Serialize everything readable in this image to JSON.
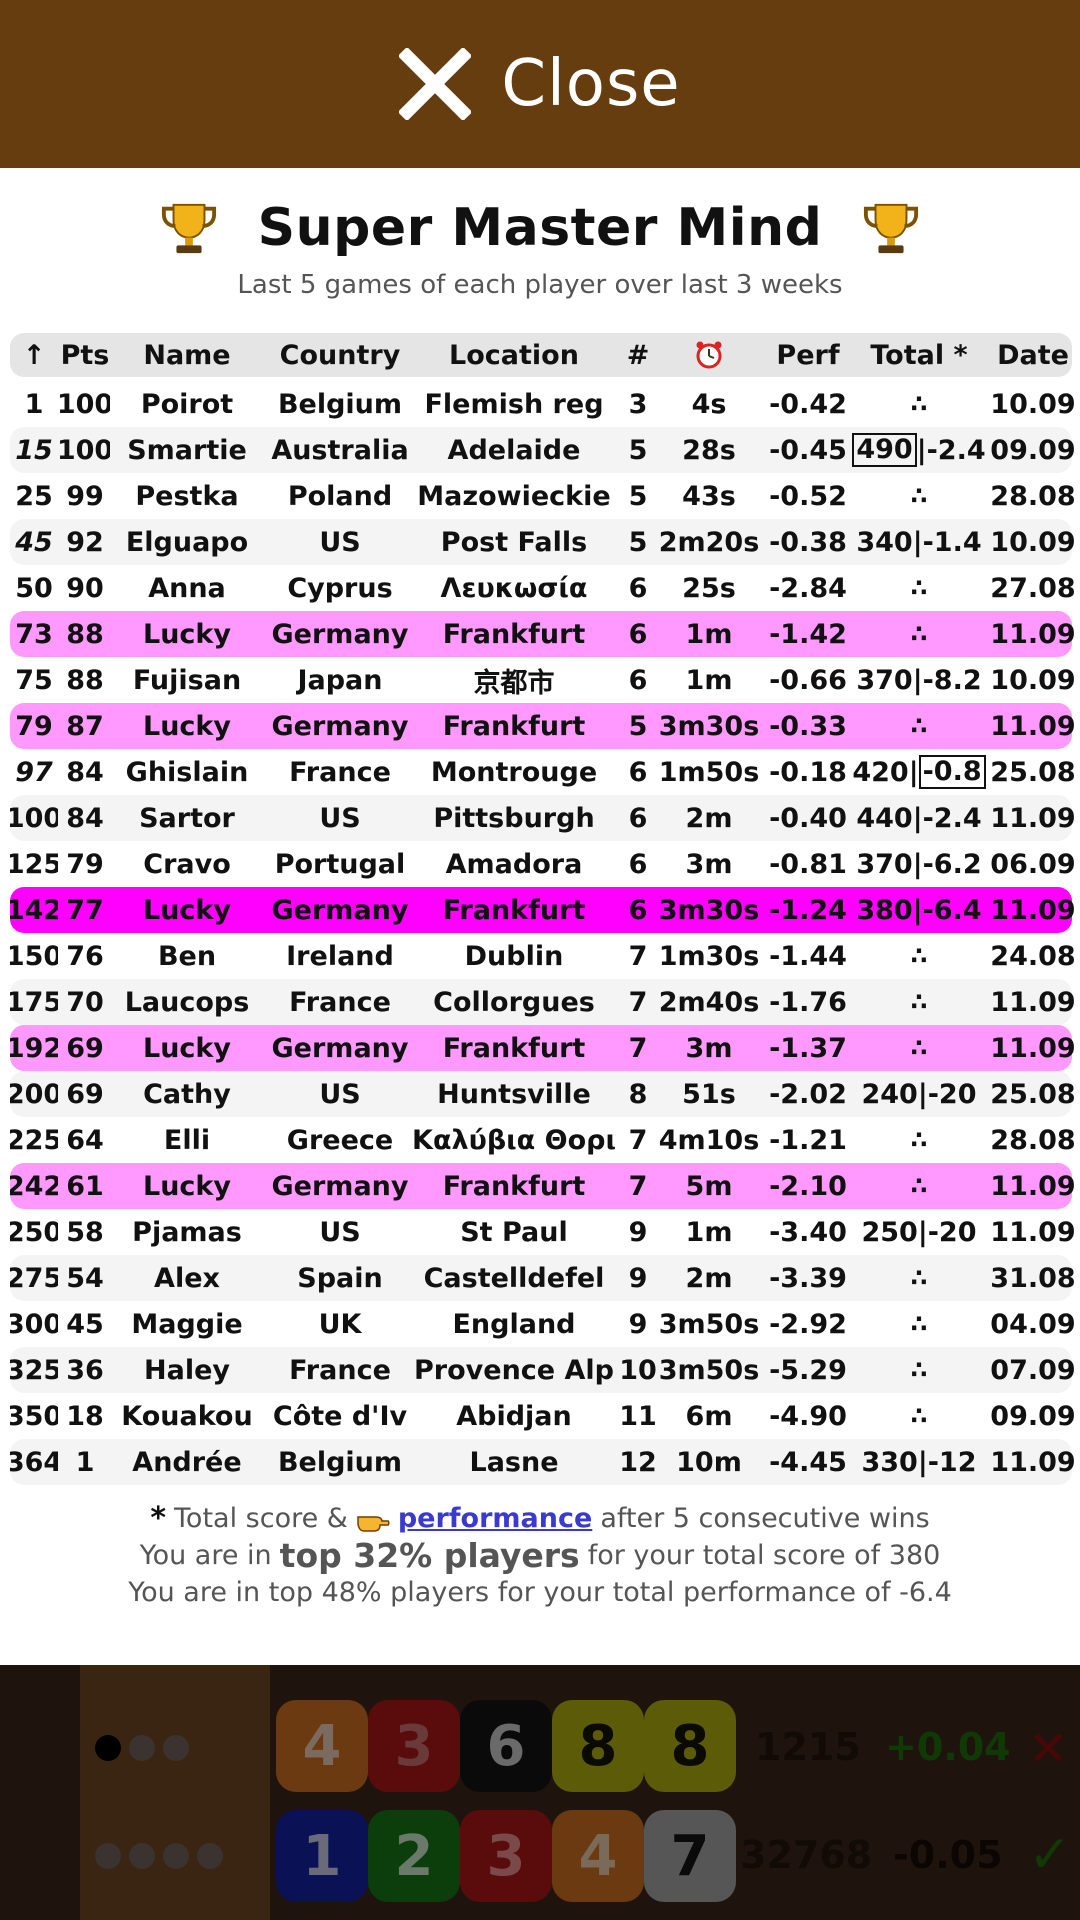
{
  "close": {
    "label": "Close"
  },
  "title": "Super Master Mind",
  "subtitle": "Last 5 games of each player over last 3 weeks",
  "columns": [
    "↑",
    "Pts",
    "Name",
    "Country",
    "Location",
    "#",
    "⏰",
    "Perf",
    "Total *",
    "Date"
  ],
  "rows": [
    {
      "rank": "1",
      "pts": "100",
      "name": "Poirot",
      "country": "Belgium",
      "location": "Flemish reg",
      "n": "3",
      "time": "4s",
      "perf": "-0.42",
      "total": "∴",
      "date": "10.09"
    },
    {
      "rank": "15",
      "pts": "100",
      "name": "Smartie",
      "country": "Australia",
      "location": "Adelaide",
      "n": "5",
      "time": "28s",
      "perf": "-0.45",
      "total_score": "490",
      "total_perf": "-2.4",
      "date": "09.09"
    },
    {
      "rank": "25",
      "pts": "99",
      "name": "Pestka",
      "country": "Poland",
      "location": "Mazowieckie",
      "n": "5",
      "time": "43s",
      "perf": "-0.52",
      "total": "∴",
      "date": "28.08"
    },
    {
      "rank": "45",
      "pts": "92",
      "name": "Elguapo",
      "country": "US",
      "location": "Post Falls",
      "n": "5",
      "time": "2m20s",
      "perf": "-0.38",
      "total": "340|-1.4",
      "date": "10.09"
    },
    {
      "rank": "50",
      "pts": "90",
      "name": "Anna",
      "country": "Cyprus",
      "location": "Λευκωσία",
      "n": "6",
      "time": "25s",
      "perf": "-2.84",
      "total": "∴",
      "date": "27.08"
    },
    {
      "rank": "73",
      "pts": "88",
      "name": "Lucky",
      "country": "Germany",
      "location": "Frankfurt",
      "n": "6",
      "time": "1m",
      "perf": "-1.42",
      "total": "∴",
      "date": "11.09"
    },
    {
      "rank": "75",
      "pts": "88",
      "name": "Fujisan",
      "country": "Japan",
      "location": "京都市",
      "n": "6",
      "time": "1m",
      "perf": "-0.66",
      "total": "370|-8.2",
      "date": "10.09"
    },
    {
      "rank": "79",
      "pts": "87",
      "name": "Lucky",
      "country": "Germany",
      "location": "Frankfurt",
      "n": "5",
      "time": "3m30s",
      "perf": "-0.33",
      "total": "∴",
      "date": "11.09"
    },
    {
      "rank": "97",
      "pts": "84",
      "name": "Ghislain",
      "country": "France",
      "location": "Montrouge",
      "n": "6",
      "time": "1m50s",
      "perf": "-0.18",
      "total_score": "420",
      "total_perf": "-0.8",
      "date": "25.08"
    },
    {
      "rank": "100",
      "pts": "84",
      "name": "Sartor",
      "country": "US",
      "location": "Pittsburgh",
      "n": "6",
      "time": "2m",
      "perf": "-0.40",
      "total": "440|-2.4",
      "date": "11.09"
    },
    {
      "rank": "125",
      "pts": "79",
      "name": "Cravo",
      "country": "Portugal",
      "location": "Amadora",
      "n": "6",
      "time": "3m",
      "perf": "-0.81",
      "total": "370|-6.2",
      "date": "06.09"
    },
    {
      "rank": "142",
      "pts": "77",
      "name": "Lucky",
      "country": "Germany",
      "location": "Frankfurt",
      "n": "6",
      "time": "3m30s",
      "perf": "-1.24",
      "total": "380|-6.4",
      "date": "11.09"
    },
    {
      "rank": "150",
      "pts": "76",
      "name": "Ben",
      "country": "Ireland",
      "location": "Dublin",
      "n": "7",
      "time": "1m30s",
      "perf": "-1.44",
      "total": "∴",
      "date": "24.08"
    },
    {
      "rank": "175",
      "pts": "70",
      "name": "Laucops",
      "country": "France",
      "location": "Collorgues",
      "n": "7",
      "time": "2m40s",
      "perf": "-1.76",
      "total": "∴",
      "date": "11.09"
    },
    {
      "rank": "192",
      "pts": "69",
      "name": "Lucky",
      "country": "Germany",
      "location": "Frankfurt",
      "n": "7",
      "time": "3m",
      "perf": "-1.37",
      "total": "∴",
      "date": "11.09"
    },
    {
      "rank": "200",
      "pts": "69",
      "name": "Cathy",
      "country": "US",
      "location": "Huntsville",
      "n": "8",
      "time": "51s",
      "perf": "-2.02",
      "total": "240|-20",
      "date": "25.08"
    },
    {
      "rank": "225",
      "pts": "64",
      "name": "Elli",
      "country": "Greece",
      "location": "Καλύβια Θορι",
      "n": "7",
      "time": "4m10s",
      "perf": "-1.21",
      "total": "∴",
      "date": "28.08"
    },
    {
      "rank": "242",
      "pts": "61",
      "name": "Lucky",
      "country": "Germany",
      "location": "Frankfurt",
      "n": "7",
      "time": "5m",
      "perf": "-2.10",
      "total": "∴",
      "date": "11.09"
    },
    {
      "rank": "250",
      "pts": "58",
      "name": "Pjamas",
      "country": "US",
      "location": "St Paul",
      "n": "9",
      "time": "1m",
      "perf": "-3.40",
      "total": "250|-20",
      "date": "11.09"
    },
    {
      "rank": "275",
      "pts": "54",
      "name": "Alex",
      "country": "Spain",
      "location": "Castelldefel",
      "n": "9",
      "time": "2m",
      "perf": "-3.39",
      "total": "∴",
      "date": "31.08"
    },
    {
      "rank": "300",
      "pts": "45",
      "name": "Maggie",
      "country": "UK",
      "location": "England",
      "n": "9",
      "time": "3m50s",
      "perf": "-2.92",
      "total": "∴",
      "date": "04.09"
    },
    {
      "rank": "325",
      "pts": "36",
      "name": "Haley",
      "country": "France",
      "location": "Provence Alp",
      "n": "10",
      "time": "3m50s",
      "perf": "-5.29",
      "total": "∴",
      "date": "07.09"
    },
    {
      "rank": "350",
      "pts": "18",
      "name": "Kouakou",
      "country": "Côte d'Iv",
      "location": "Abidjan",
      "n": "11",
      "time": "6m",
      "perf": "-4.90",
      "total": "∴",
      "date": "09.09"
    },
    {
      "rank": "364",
      "pts": "1",
      "name": "Andrée",
      "country": "Belgium",
      "location": "Lasne",
      "n": "12",
      "time": "10m",
      "perf": "-4.45",
      "total": "330|-12",
      "date": "11.09"
    }
  ],
  "footer": {
    "star": "*",
    "note_a": "Total score &",
    "link": "performance",
    "note_b": "after 5 consecutive wins",
    "line2_a": "You are in",
    "line2_big": "top 32% players",
    "line2_b": "for your total score of 380",
    "line3": "You are in top 48% players for your total performance of -6.4"
  },
  "board": {
    "row1_pegs": [
      "4",
      "3",
      "6",
      "8",
      "8"
    ],
    "row1_code": "1215",
    "row1_perf": "+0.04",
    "row2_pegs": [
      "1",
      "2",
      "3",
      "4",
      "7"
    ],
    "row2_code": "32768",
    "row2_perf": "-0.05"
  },
  "colors": {
    "topbar": "#663d0f",
    "highlight": "#ff99ff",
    "current": "#ff00ff",
    "link": "#3a3ad0"
  }
}
